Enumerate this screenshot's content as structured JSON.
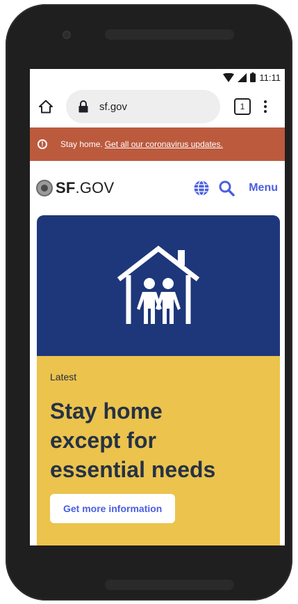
{
  "status_bar": {
    "time": "11:11"
  },
  "browser": {
    "url": "sf.gov",
    "tab_count": "1"
  },
  "alert": {
    "text": "Stay home.",
    "link": "Get all our coronavirus updates."
  },
  "site_header": {
    "logo_bold": "SF",
    "logo_rest": ".GOV",
    "menu_label": "Menu"
  },
  "hero": {
    "kicker": "Latest",
    "headline": [
      "Stay home",
      "except for",
      "essential needs"
    ],
    "cta_label": "Get more information"
  },
  "colors": {
    "alert_bg": "#bc5a3e",
    "card_top": "#1d377a",
    "card_bottom": "#ebc34d",
    "accent": "#4a5ee0"
  },
  "icons": [
    "home-icon",
    "lock-icon",
    "tabs-icon",
    "more-icon",
    "alert-icon",
    "globe-icon",
    "search-icon",
    "house-family-icon",
    "seal-icon"
  ]
}
